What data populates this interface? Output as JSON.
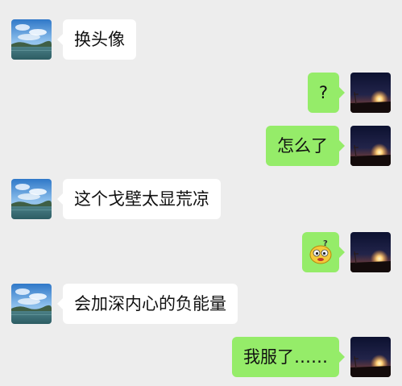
{
  "conversation": {
    "messages": [
      {
        "side": "left",
        "avatar": "seaside-landscape-avatar",
        "text": "换头像"
      },
      {
        "side": "right",
        "avatar": "sunset-night-sky-avatar",
        "text": "?"
      },
      {
        "side": "right",
        "avatar": "sunset-night-sky-avatar",
        "text": "怎么了"
      },
      {
        "side": "left",
        "avatar": "seaside-landscape-avatar",
        "text": "这个戈壁太显荒凉"
      },
      {
        "side": "right",
        "avatar": "sunset-night-sky-avatar",
        "emoji": "confused-face-emoji"
      },
      {
        "side": "left",
        "avatar": "seaside-landscape-avatar",
        "text": "会加深内心的负能量"
      },
      {
        "side": "right",
        "avatar": "sunset-night-sky-avatar",
        "text": "我服了……"
      }
    ]
  },
  "colors": {
    "background": "#ededed",
    "incoming_bubble": "#ffffff",
    "outgoing_bubble": "#95ec69"
  }
}
